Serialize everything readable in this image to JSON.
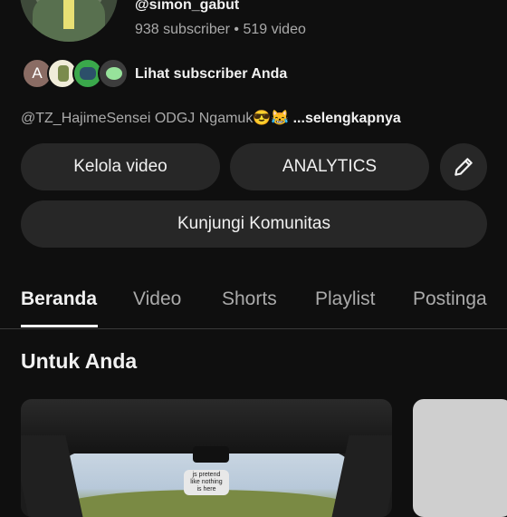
{
  "channel": {
    "handle": "@simon_gabut",
    "subscribers": "938 subscriber",
    "separator": "•",
    "videos": "519 video",
    "subscriber_avatars": [
      {
        "letter": "A",
        "color": "#8a6c64"
      },
      {
        "letter": "",
        "color": "#f0ecd9"
      },
      {
        "letter": "",
        "color": "#3aa84b"
      },
      {
        "letter": "",
        "color": "#3d3d3d"
      }
    ],
    "view_subscribers_label": "Lihat subscriber Anda",
    "description": "@TZ_HajimeSensei ODGJ Ngamuk😎😹",
    "more_label": "...selengkapnya"
  },
  "actions": {
    "manage_videos": "Kelola video",
    "analytics": "ANALYTICS",
    "edit_icon": "pencil-icon",
    "community": "Kunjungi Komunitas"
  },
  "tabs": [
    {
      "label": "Beranda",
      "active": true
    },
    {
      "label": "Video",
      "active": false
    },
    {
      "label": "Shorts",
      "active": false
    },
    {
      "label": "Playlist",
      "active": false
    },
    {
      "label": "Postinga",
      "active": false
    }
  ],
  "section": {
    "title": "Untuk Anda"
  },
  "videos": [
    {
      "caption": "js pretend like nothing is here"
    }
  ],
  "colors": {
    "background": "#0f0f0f",
    "button": "#272727",
    "text_primary": "#f1f1f1",
    "text_secondary": "#aaaaaa"
  }
}
